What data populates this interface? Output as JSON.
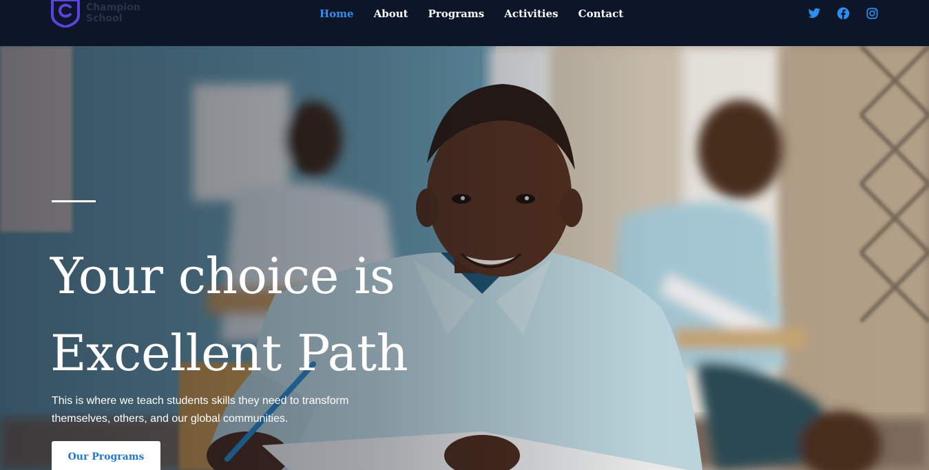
{
  "brand": {
    "logo_lines": [
      "Champion",
      "School"
    ],
    "logo_icon": "shield-c-icon",
    "accent": "#5a43e0"
  },
  "nav": {
    "items": [
      {
        "label": "Home",
        "active": true
      },
      {
        "label": "About",
        "active": false
      },
      {
        "label": "Programs",
        "active": false
      },
      {
        "label": "Activities",
        "active": false
      },
      {
        "label": "Contact",
        "active": false
      }
    ],
    "active_color": "#2f8ff0"
  },
  "social": {
    "icons": [
      "twitter-icon",
      "facebook-icon",
      "instagram-icon"
    ],
    "color": "#2f8ff0"
  },
  "hero": {
    "title_lines": [
      "Your choice is",
      "Excellent Path"
    ],
    "description": "This is where we teach students skills they need to transform themselves, others, and our global communities.",
    "cta_label": "Our Programs",
    "cta_color": "#1e78d6"
  }
}
